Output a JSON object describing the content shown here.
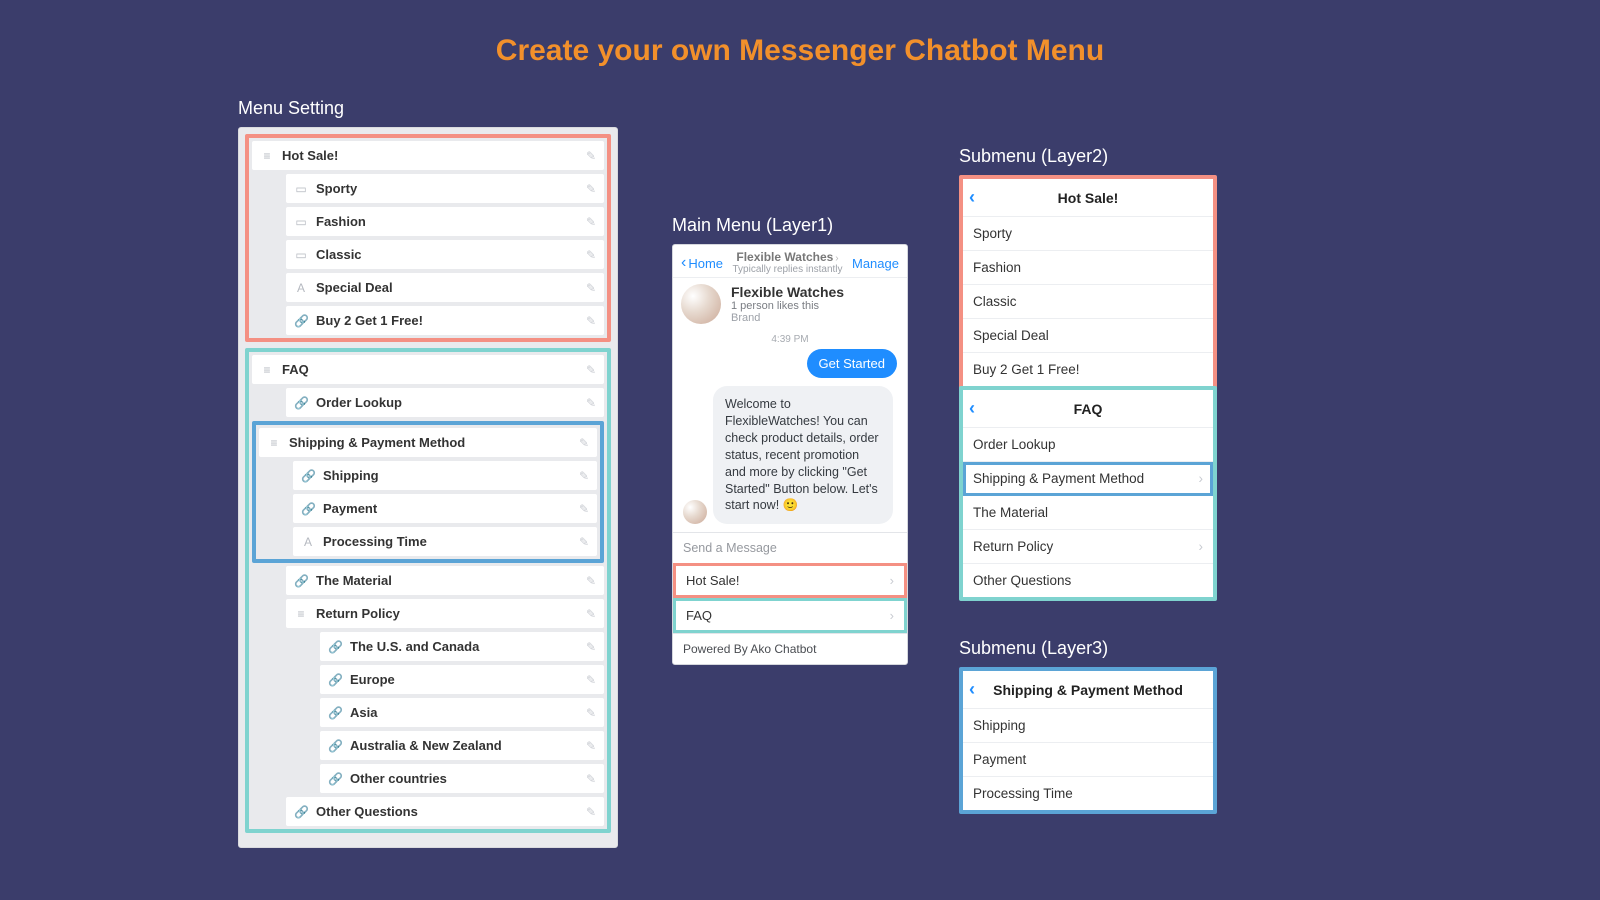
{
  "title": "Create your own Messenger Chatbot Menu",
  "labels": {
    "menu_setting": "Menu Setting",
    "layer1": "Main Menu (Layer1)",
    "layer2": "Submenu (Layer2)",
    "layer3": "Submenu (Layer3)"
  },
  "menu_setting": {
    "group1": {
      "title": "Hot Sale!",
      "items": [
        "Sporty",
        "Fashion",
        "Classic",
        "Special Deal",
        "Buy 2 Get 1 Free!"
      ]
    },
    "group2": {
      "title": "FAQ",
      "order_lookup": "Order Lookup",
      "ship_pay": {
        "title": "Shipping & Payment Method",
        "items": [
          "Shipping",
          "Payment",
          "Processing Time"
        ]
      },
      "material": "The Material",
      "return_policy": {
        "title": "Return Policy",
        "items": [
          "The U.S. and Canada",
          "Europe",
          "Asia",
          "Australia & New Zealand",
          "Other countries"
        ]
      },
      "other_q": "Other Questions"
    }
  },
  "phone": {
    "home": "Home",
    "header_title": "Flexible Watches",
    "header_sub": "Typically replies instantly",
    "manage": "Manage",
    "profile_name": "Flexible Watches",
    "profile_likes": "1 person likes this",
    "profile_brand": "Brand",
    "time": "4:39 PM",
    "user_msg": "Get Started",
    "bot_msg": "Welcome to FlexibleWatches! You can check product details, order status, recent promotion and more by clicking \"Get Started\" Button below. Let's start now! 🙂",
    "input_placeholder": "Send a Message",
    "menu1": "Hot Sale!",
    "menu2": "FAQ",
    "powered": "Powered By Ako Chatbot"
  },
  "sub_l2a": {
    "title": "Hot Sale!",
    "items": [
      "Sporty",
      "Fashion",
      "Classic",
      "Special Deal",
      "Buy 2 Get 1 Free!"
    ]
  },
  "sub_l2b": {
    "title": "FAQ",
    "items": [
      {
        "label": "Order Lookup",
        "chev": false,
        "hl": false
      },
      {
        "label": "Shipping & Payment Method",
        "chev": true,
        "hl": true
      },
      {
        "label": "The Material",
        "chev": false,
        "hl": false
      },
      {
        "label": "Return Policy",
        "chev": true,
        "hl": false
      },
      {
        "label": "Other Questions",
        "chev": false,
        "hl": false
      }
    ]
  },
  "sub_l3": {
    "title": "Shipping & Payment Method",
    "items": [
      "Shipping",
      "Payment",
      "Processing Time"
    ]
  }
}
